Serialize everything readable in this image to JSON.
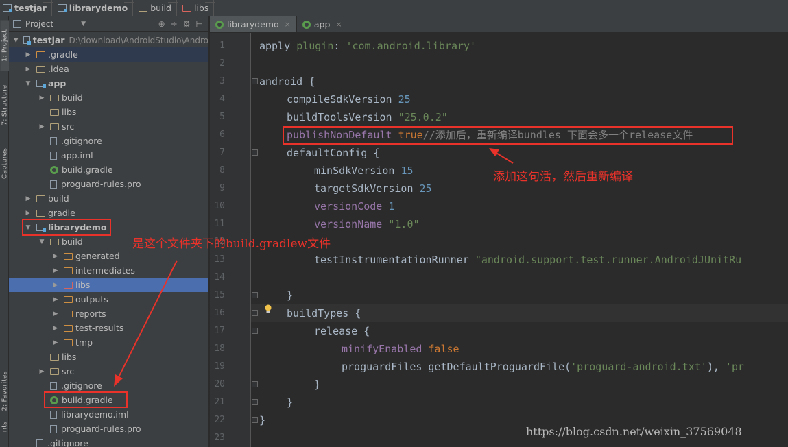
{
  "breadcrumbs": [
    "testjar",
    "librarydemo",
    "build",
    "libs"
  ],
  "toolstrip": {
    "project_tab": "1: Project",
    "structure_tab": "7: Structure",
    "captures_tab": "Captures",
    "favorites_tab": "2: Favorites",
    "bottom_tab": "nts"
  },
  "project_panel": {
    "title": "Project",
    "tree": [
      {
        "label": "testjar",
        "path": "D:\\download\\AndroidStudio\\Andro"
      },
      {
        "label": ".gradle"
      },
      {
        "label": ".idea"
      },
      {
        "label": "app"
      },
      {
        "label": "build"
      },
      {
        "label": "libs"
      },
      {
        "label": "src"
      },
      {
        "label": ".gitignore"
      },
      {
        "label": "app.iml"
      },
      {
        "label": "build.gradle"
      },
      {
        "label": "proguard-rules.pro"
      },
      {
        "label": "build"
      },
      {
        "label": "gradle"
      },
      {
        "label": "librarydemo"
      },
      {
        "label": "build"
      },
      {
        "label": "generated"
      },
      {
        "label": "intermediates"
      },
      {
        "label": "libs"
      },
      {
        "label": "outputs"
      },
      {
        "label": "reports"
      },
      {
        "label": "test-results"
      },
      {
        "label": "tmp"
      },
      {
        "label": "libs"
      },
      {
        "label": "src"
      },
      {
        "label": ".gitignore"
      },
      {
        "label": "build.gradle"
      },
      {
        "label": "librarydemo.iml"
      },
      {
        "label": "proguard-rules.pro"
      },
      {
        "label": ".gitignore"
      }
    ]
  },
  "editor": {
    "tabs": [
      {
        "label": "librarydemo",
        "close": "×"
      },
      {
        "label": "app",
        "close": "×"
      }
    ],
    "line_numbers": [
      "1",
      "2",
      "3",
      "4",
      "5",
      "6",
      "7",
      "8",
      "9",
      "10",
      "11",
      "12",
      "13",
      "14",
      "15",
      "16",
      "17",
      "18",
      "19",
      "20",
      "21",
      "22",
      "23"
    ],
    "code": {
      "l1_a": "apply ",
      "l1_b": "plugin",
      "l1_c": ": ",
      "l1_d": "'com.android.library'",
      "l3": "android {",
      "l4_a": "compileSdkVersion ",
      "l4_b": "25",
      "l5_a": "buildToolsVersion ",
      "l5_b": "\"25.0.2\"",
      "l6_a": "publishNonDefault ",
      "l6_b": "true",
      "l6_c": "//添加后，重新编译bundles 下面会多一个release文件",
      "l7": "defaultConfig {",
      "l8_a": "minSdkVersion ",
      "l8_b": "15",
      "l9_a": "targetSdkVersion ",
      "l9_b": "25",
      "l10_a": "versionCode ",
      "l10_b": "1",
      "l11_a": "versionName ",
      "l11_b": "\"1.0\"",
      "l13_a": "testInstrumentationRunner ",
      "l13_b": "\"android.support.test.runner.AndroidJUnitRu",
      "l15": "}",
      "l16": "buildTypes {",
      "l17": "release {",
      "l18_a": "minifyEnabled ",
      "l18_b": "false",
      "l19_a": "proguardFiles getDefaultProguardFile(",
      "l19_b": "'proguard-android.txt'",
      "l19_c": "), ",
      "l19_d": "'pr",
      "l20": "}",
      "l21": "}",
      "l22": "}"
    }
  },
  "annotations": {
    "note_line6": "添加这句活，然后重新编译",
    "note_folder": "是这个文件夹下的build.gradlew文件"
  },
  "watermark": "https://blog.csdn.net/weixin_37569048",
  "colors": {
    "annotation": "#e8322a",
    "selection": "#4b6eaf",
    "keyword": "#cc7832",
    "string": "#6a8759",
    "number": "#6897bb",
    "property": "#9876aa"
  }
}
